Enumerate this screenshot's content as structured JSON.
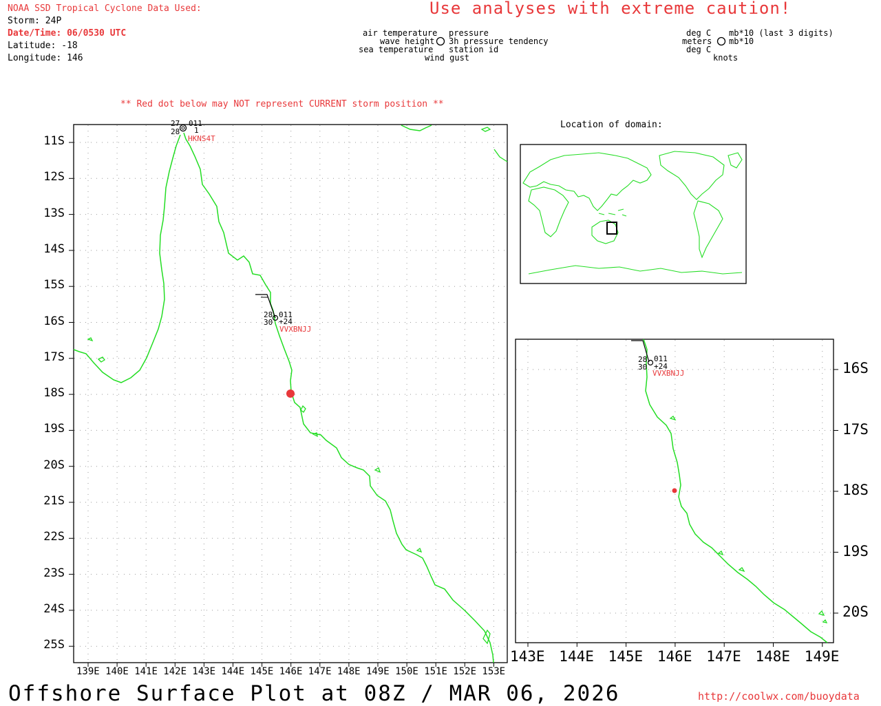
{
  "header": {
    "source": "NOAA SSD Tropical Cyclone Data Used:",
    "storm": "Storm: 24P",
    "datetime": "Date/Time: 06/0530 UTC",
    "latitude": "Latitude: -18",
    "longitude": "Longitude: 146",
    "caution": "Use analyses with extreme caution!"
  },
  "legend": {
    "left_labels": [
      "air temperature",
      "wave height",
      "sea temperature"
    ],
    "right_labels": [
      "pressure",
      "3h pressure tendency",
      "station id"
    ],
    "bottom_label": "wind gust",
    "unit_left": [
      "deg C",
      "meters",
      "deg C"
    ],
    "unit_right": [
      "mb*10 (last 3 digits)",
      "mb*10"
    ],
    "unit_bottom": "knots"
  },
  "storm_note": "** Red dot below may NOT represent CURRENT storm position **",
  "inset_title": "Location of domain:",
  "main_map": {
    "lat_labels": [
      "11S",
      "12S",
      "13S",
      "14S",
      "15S",
      "16S",
      "17S",
      "18S",
      "19S",
      "20S",
      "21S",
      "22S",
      "23S",
      "24S",
      "25S"
    ],
    "lon_labels": [
      "139E",
      "140E",
      "141E",
      "142E",
      "143E",
      "144E",
      "145E",
      "146E",
      "147E",
      "148E",
      "149E",
      "150E",
      "151E",
      "152E",
      "153E"
    ],
    "stations": [
      {
        "id": "HKNS4T",
        "air_temp": "27",
        "sea_temp": "28",
        "pressure": "011",
        "tendency": "1"
      },
      {
        "id": "VVXBNJJ",
        "air_temp": "28",
        "sea_temp": "30",
        "pressure": "011",
        "tendency": "+24"
      }
    ],
    "storm_position": {
      "lat": -18,
      "lon": 146
    }
  },
  "zoom_map": {
    "lat_labels": [
      "16S",
      "17S",
      "18S",
      "19S",
      "20S"
    ],
    "lon_labels": [
      "143E",
      "144E",
      "145E",
      "146E",
      "147E",
      "148E",
      "149E"
    ],
    "station": {
      "id": "VVXBNJJ",
      "air_temp": "28",
      "sea_temp": "30",
      "pressure": "011",
      "tendency": "+24"
    }
  },
  "footer": {
    "title": "Offshore Surface Plot at 08Z / MAR 06, 2026",
    "url": "http://coolwx.com/buoydata"
  },
  "colors": {
    "coast": "#22dd22",
    "accent": "#e8383a",
    "grid": "#999999"
  }
}
